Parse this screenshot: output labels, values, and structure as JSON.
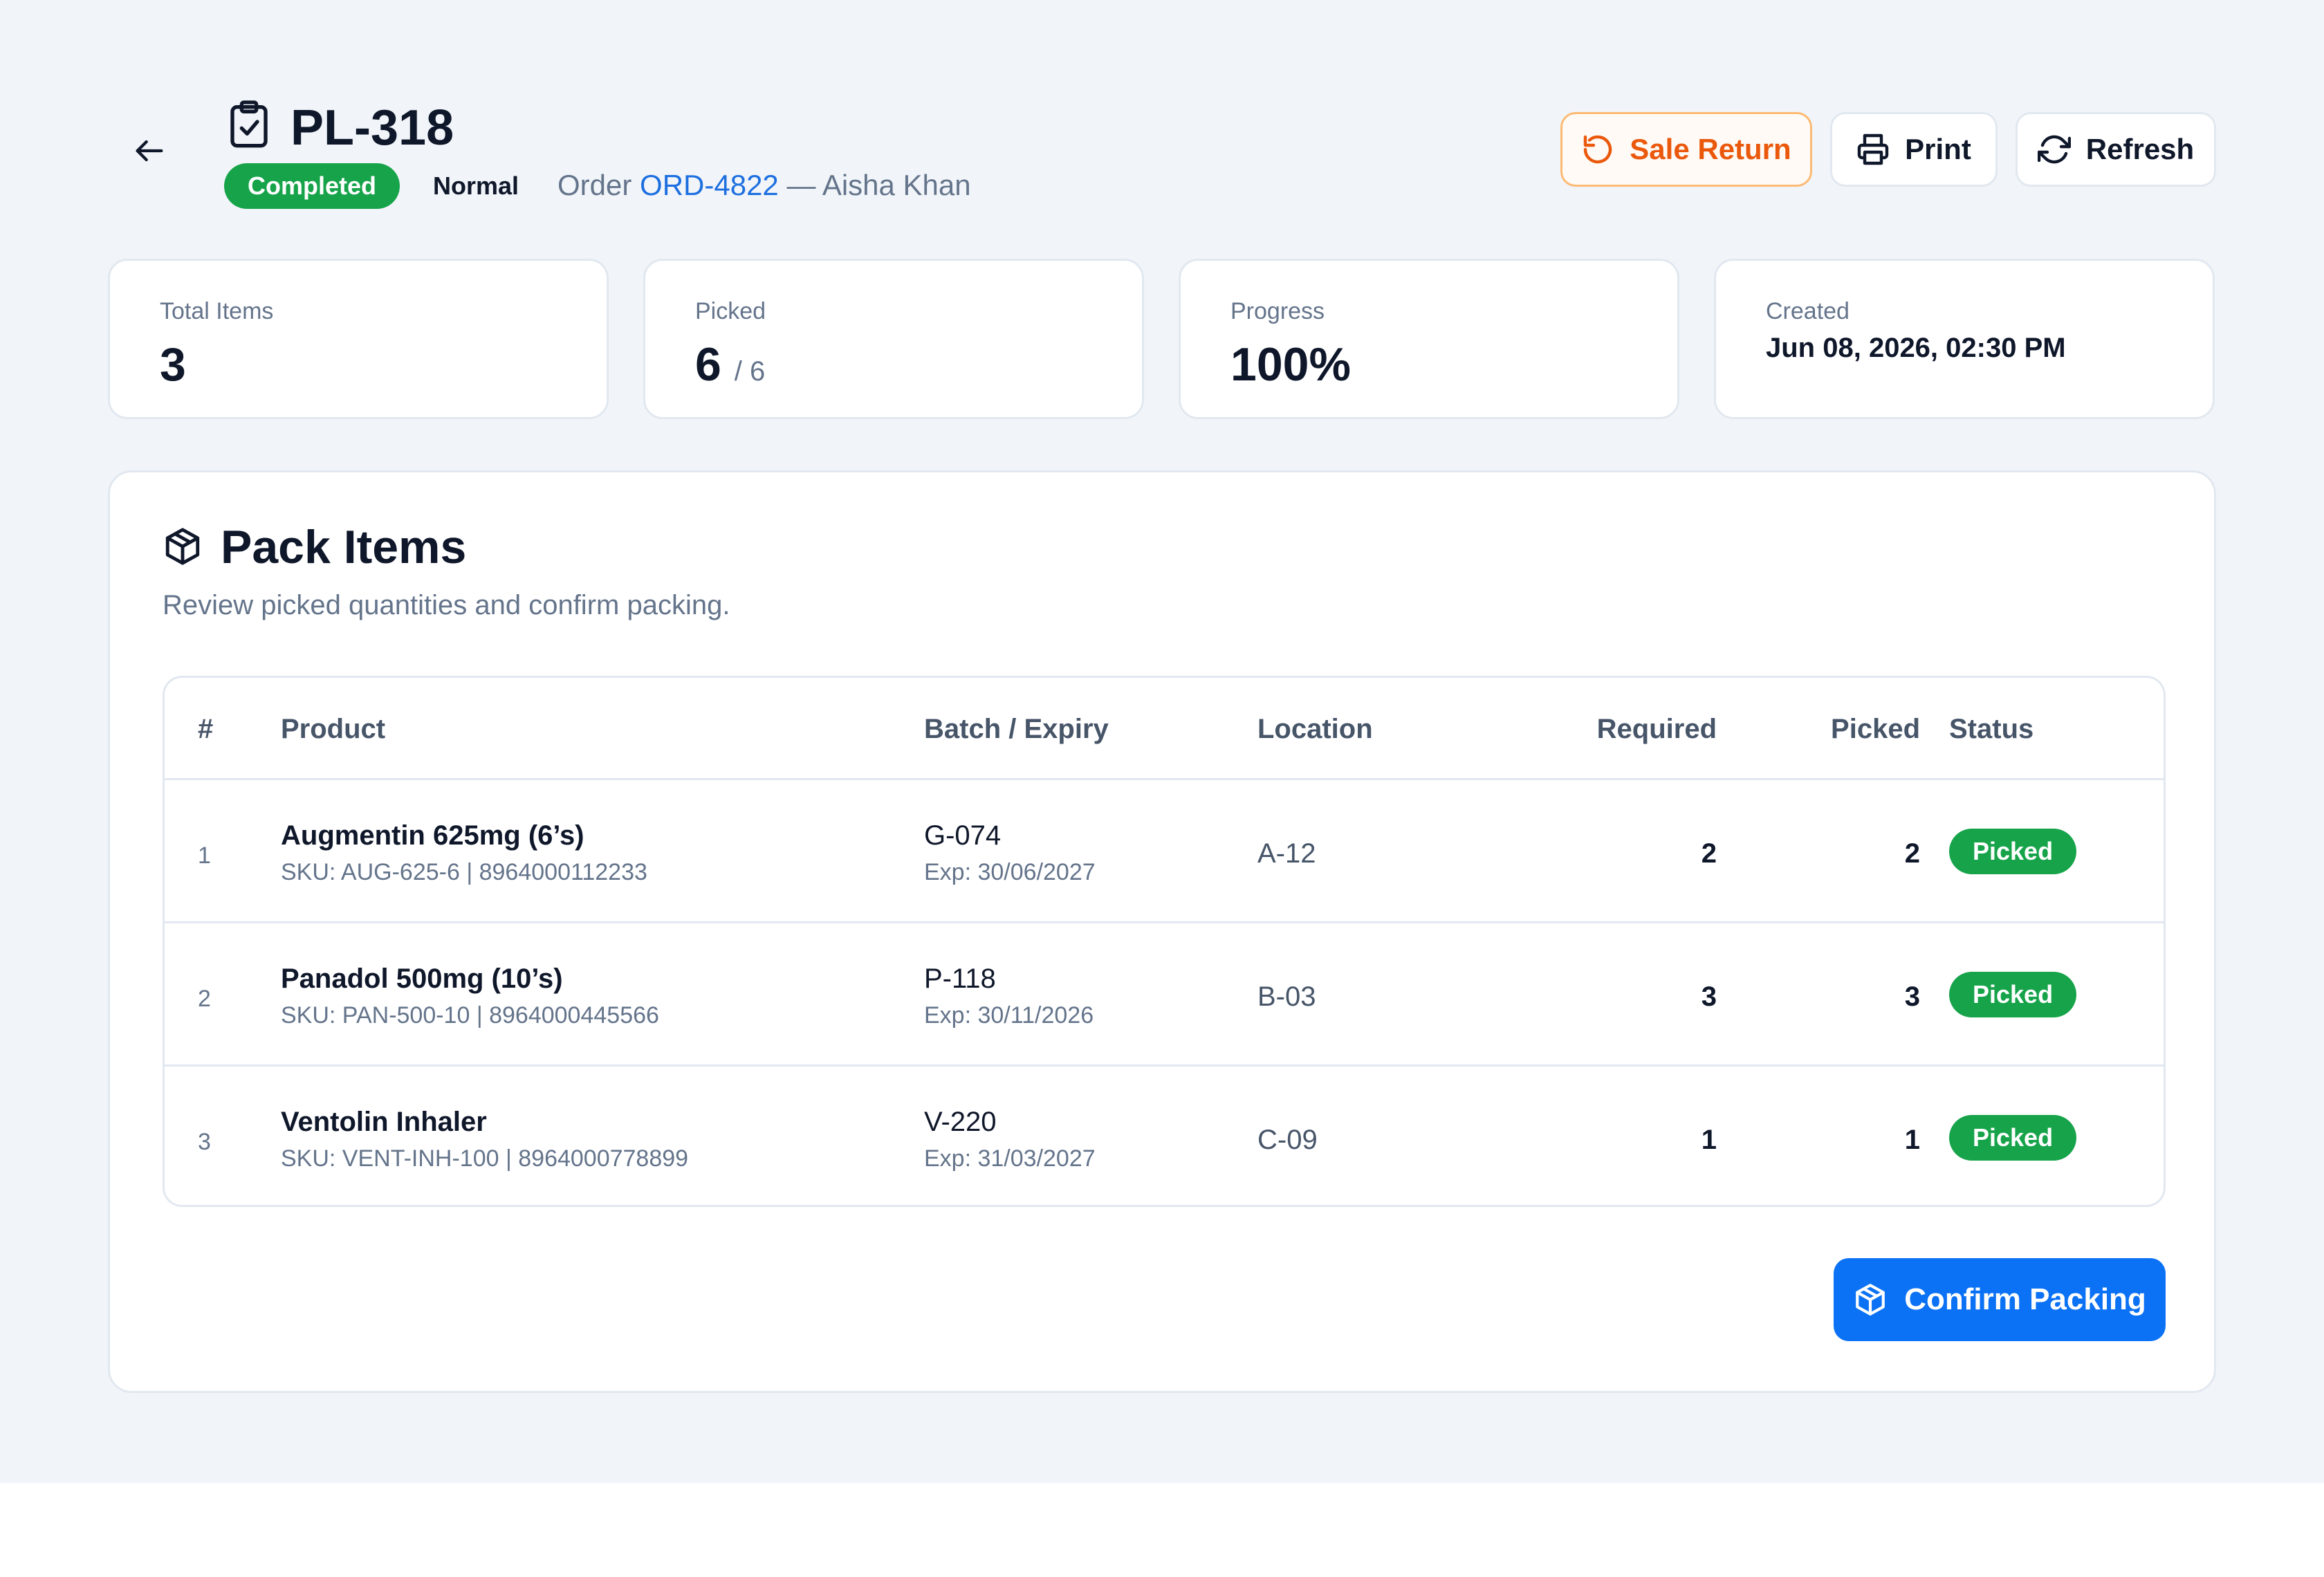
{
  "header": {
    "title": "PL-318",
    "status": "Completed",
    "priority": "Normal",
    "order_prefix": "Order ",
    "order_id": "ORD-4822",
    "order_suffix": " — Aisha Khan",
    "buttons": {
      "sale_return": "Sale Return",
      "print": "Print",
      "refresh": "Refresh"
    },
    "icons": [
      "arrow-left-icon",
      "clipboard-check-icon",
      "rotate-ccw-icon",
      "printer-icon",
      "refresh-icon"
    ]
  },
  "stats": {
    "total_items": {
      "label": "Total Items",
      "value": "3"
    },
    "picked": {
      "label": "Picked",
      "value": "6",
      "of": "/ 6"
    },
    "progress": {
      "label": "Progress",
      "value": "100%"
    },
    "created": {
      "label": "Created",
      "value": "Jun 08, 2026, 02:30 PM"
    }
  },
  "pack": {
    "title": "Pack Items",
    "subtitle": "Review picked quantities and confirm packing.",
    "icon": "package-icon",
    "columns": [
      "#",
      "Product",
      "Batch / Expiry",
      "Location",
      "Required",
      "Picked",
      "Status"
    ],
    "rows": [
      {
        "num": "1",
        "name": "Augmentin 625mg (6’s)",
        "sku": "SKU: AUG-625-6 | 8964000112233",
        "batch": "G-074",
        "expiry": "Exp: 30/06/2027",
        "location": "A-12",
        "required": "2",
        "picked": "2",
        "status": "Picked"
      },
      {
        "num": "2",
        "name": "Panadol 500mg (10’s)",
        "sku": "SKU: PAN-500-10 | 8964000445566",
        "batch": "P-118",
        "expiry": "Exp: 30/11/2026",
        "location": "B-03",
        "required": "3",
        "picked": "3",
        "status": "Picked"
      },
      {
        "num": "3",
        "name": "Ventolin Inhaler",
        "sku": "SKU: VENT-INH-100 | 8964000778899",
        "batch": "V-220",
        "expiry": "Exp: 31/03/2027",
        "location": "C-09",
        "required": "1",
        "picked": "1",
        "status": "Picked"
      }
    ],
    "confirm_label": "Confirm Packing"
  },
  "colors": {
    "background": "#f1f5f9",
    "success": "#16a34a",
    "primary": "#0b72f5",
    "warning": "#ea580c",
    "link": "#1d6fe0"
  }
}
